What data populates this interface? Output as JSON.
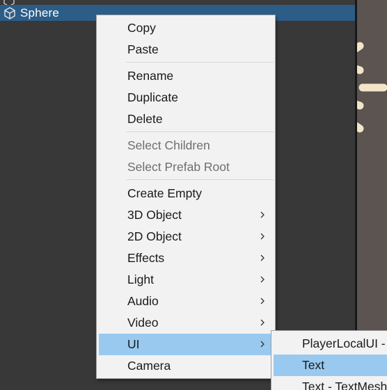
{
  "hierarchy": {
    "selected_item": "Sphere",
    "selected_icon": "cube-icon"
  },
  "context_menu": {
    "items": [
      {
        "label": "Copy",
        "enabled": true,
        "submenu": false
      },
      {
        "label": "Paste",
        "enabled": true,
        "submenu": false
      },
      {
        "label": "Rename",
        "enabled": true,
        "submenu": false
      },
      {
        "label": "Duplicate",
        "enabled": true,
        "submenu": false
      },
      {
        "label": "Delete",
        "enabled": true,
        "submenu": false
      },
      {
        "label": "Select Children",
        "enabled": false,
        "submenu": false
      },
      {
        "label": "Select Prefab Root",
        "enabled": false,
        "submenu": false
      },
      {
        "label": "Create Empty",
        "enabled": true,
        "submenu": false
      },
      {
        "label": "3D Object",
        "enabled": true,
        "submenu": true
      },
      {
        "label": "2D Object",
        "enabled": true,
        "submenu": true
      },
      {
        "label": "Effects",
        "enabled": true,
        "submenu": true
      },
      {
        "label": "Light",
        "enabled": true,
        "submenu": true
      },
      {
        "label": "Audio",
        "enabled": true,
        "submenu": true
      },
      {
        "label": "Video",
        "enabled": true,
        "submenu": true
      },
      {
        "label": "UI",
        "enabled": true,
        "submenu": true,
        "highlighted": true
      },
      {
        "label": "Camera",
        "enabled": true,
        "submenu": false
      }
    ]
  },
  "ui_submenu": {
    "items": [
      {
        "label": "PlayerLocalUI - c"
      },
      {
        "label": "Text",
        "highlighted": true
      },
      {
        "label": "Text - TextMeshP"
      }
    ]
  },
  "colors": {
    "panel_bg": "#383838",
    "selection_row": "#2c5d87",
    "menu_bg": "#f2f2f2",
    "menu_highlight": "#99c9ef",
    "disabled_text": "#6e6e6e",
    "scene_bg": "#5c5450",
    "scene_object": "#f3e6c8"
  }
}
